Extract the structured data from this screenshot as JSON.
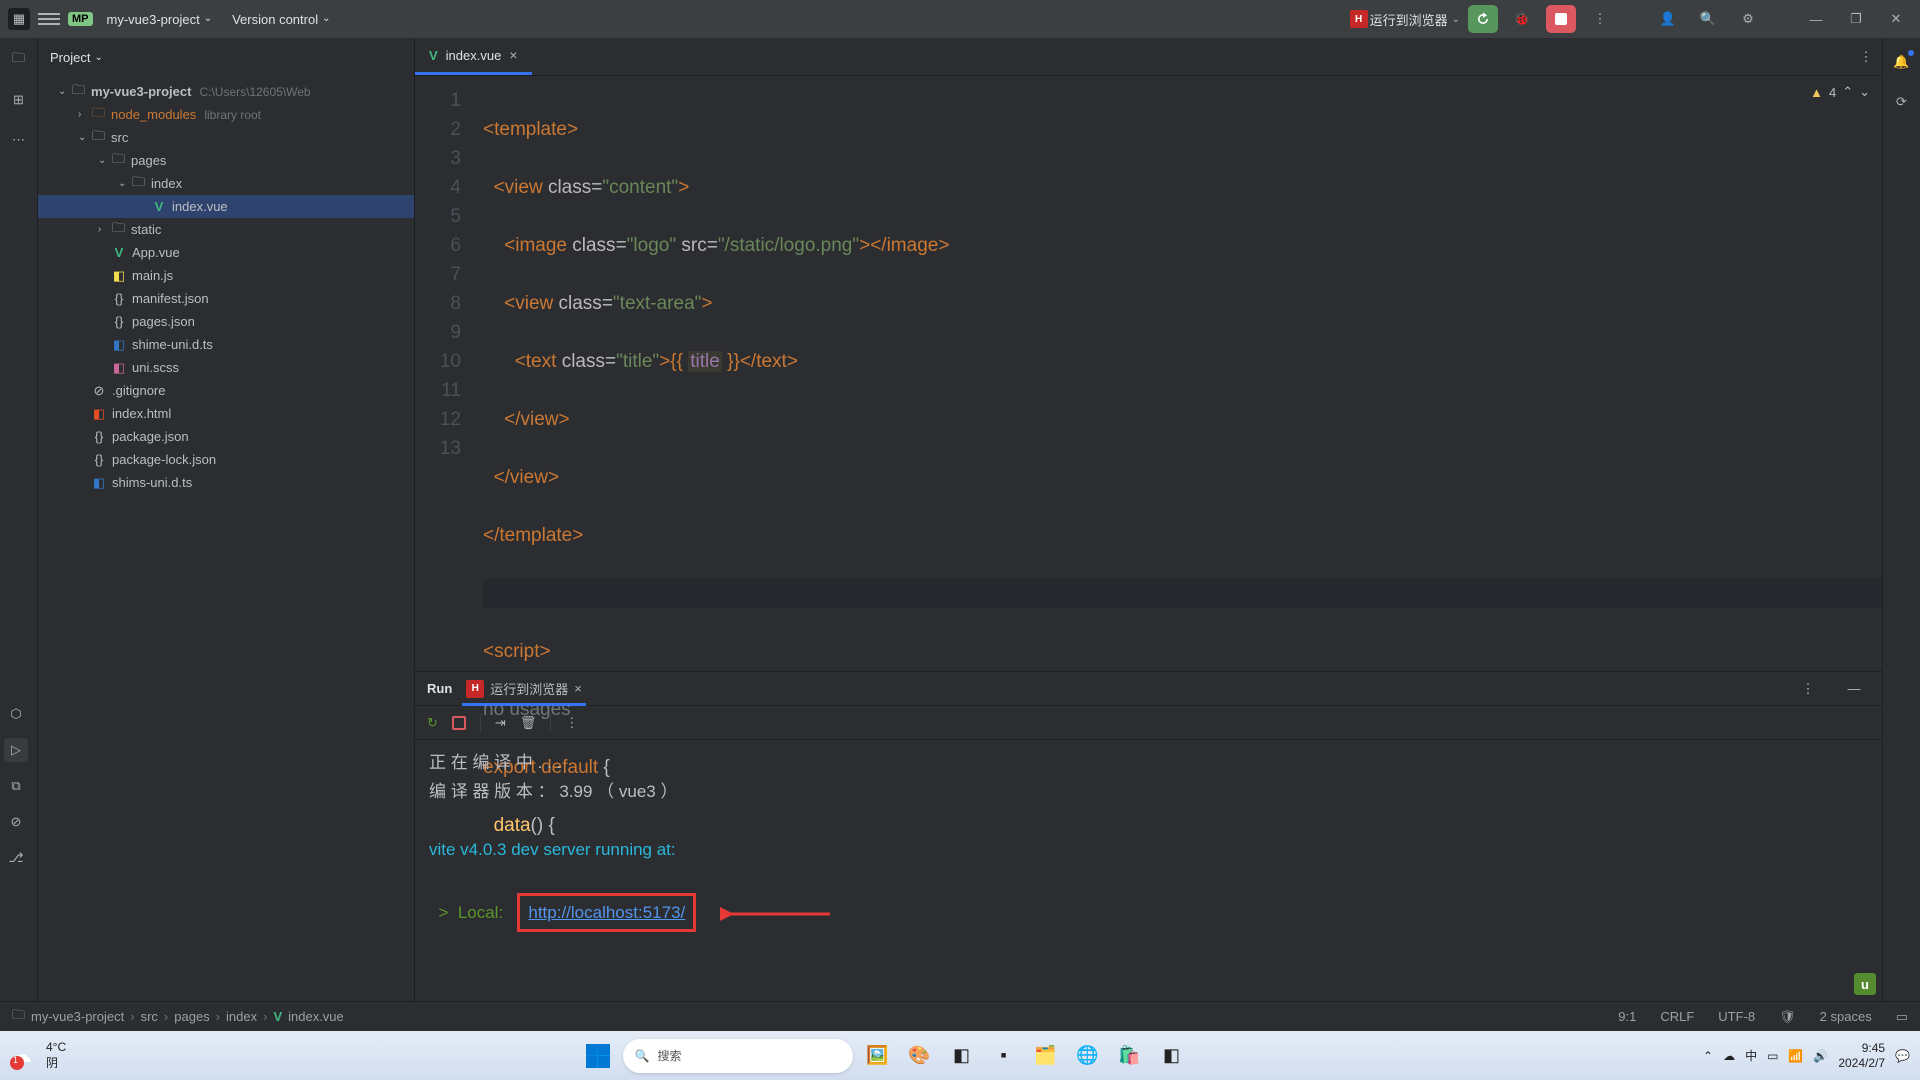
{
  "titlebar": {
    "project_badge": "MP",
    "project_name": "my-vue3-project",
    "version_control": "Version control",
    "run_config": "运行到浏览器"
  },
  "project": {
    "header": "Project",
    "root": "my-vue3-project",
    "root_path": "C:\\Users\\12605\\Web",
    "node_modules": "node_modules",
    "node_modules_hint": "library root",
    "src": "src",
    "pages": "pages",
    "index_folder": "index",
    "index_vue": "index.vue",
    "static": "static",
    "app_vue": "App.vue",
    "main_js": "main.js",
    "manifest": "manifest.json",
    "pages_json": "pages.json",
    "shime_uni": "shime-uni.d.ts",
    "uni_scss": "uni.scss",
    "gitignore": ".gitignore",
    "index_html": "index.html",
    "package_json": "package.json",
    "package_lock": "package-lock.json",
    "shims_uni": "shims-uni.d.ts"
  },
  "editor": {
    "tab_name": "index.vue",
    "lines": [
      "1",
      "2",
      "3",
      "4",
      "5",
      "6",
      "7",
      "8",
      "9",
      "10",
      "11",
      "12",
      "13"
    ],
    "no_usages": "no usages",
    "title_var": "title",
    "warn_count": "4"
  },
  "run_panel": {
    "run_label": "Run",
    "cfg_label": "运行到浏览器",
    "t1": "正 在 编 译 中 . . .",
    "t2": "编 译 器 版 本 ： 3.99 （ vue3 ）",
    "t3": "vite v4.0.3 dev server running at:",
    "t4_prefix": "  >  Local:   ",
    "url": "http://localhost:5173/"
  },
  "breadcrumb": {
    "items": [
      "my-vue3-project",
      "src",
      "pages",
      "index",
      "index.vue"
    ],
    "pos": "9:1",
    "crlf": "CRLF",
    "enc": "UTF-8",
    "indent": "2 spaces"
  },
  "taskbar": {
    "temp": "4°C",
    "weather": "阴",
    "alert": "1",
    "search_placeholder": "搜索",
    "time": "9:45",
    "date": "2024/2/7"
  }
}
